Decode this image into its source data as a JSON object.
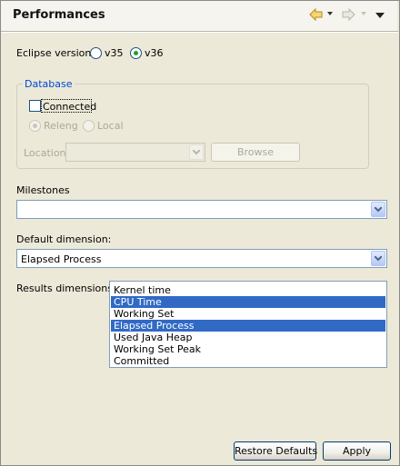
{
  "header": {
    "title": "Performances"
  },
  "eclipse_version": {
    "label": "Eclipse version",
    "options": [
      "v35",
      "v36"
    ],
    "selected": "v36"
  },
  "database": {
    "title": "Database",
    "connected_label": "Connected",
    "connected_checked": false,
    "source_options": [
      "Releng",
      "Local"
    ],
    "location_label": "Location",
    "location_value": "",
    "browse_label": "Browse"
  },
  "milestones": {
    "label": "Milestones",
    "value": ""
  },
  "default_dimension": {
    "label": "Default dimension:",
    "value": "Elapsed Process"
  },
  "results_dimensions": {
    "label": "Results dimensions:",
    "items": [
      {
        "label": "Kernel time",
        "selected": false
      },
      {
        "label": "CPU Time",
        "selected": true
      },
      {
        "label": "Working Set",
        "selected": false
      },
      {
        "label": "Elapsed Process",
        "selected": true
      },
      {
        "label": "Used Java Heap",
        "selected": false
      },
      {
        "label": "Working Set Peak",
        "selected": false
      },
      {
        "label": "Committed",
        "selected": false
      }
    ]
  },
  "footer": {
    "restore_defaults_label": "Restore Defaults",
    "apply_label": "Apply"
  },
  "colors": {
    "accent": "#316ac5",
    "group_title": "#0046d5",
    "background": "#ece9d8"
  }
}
